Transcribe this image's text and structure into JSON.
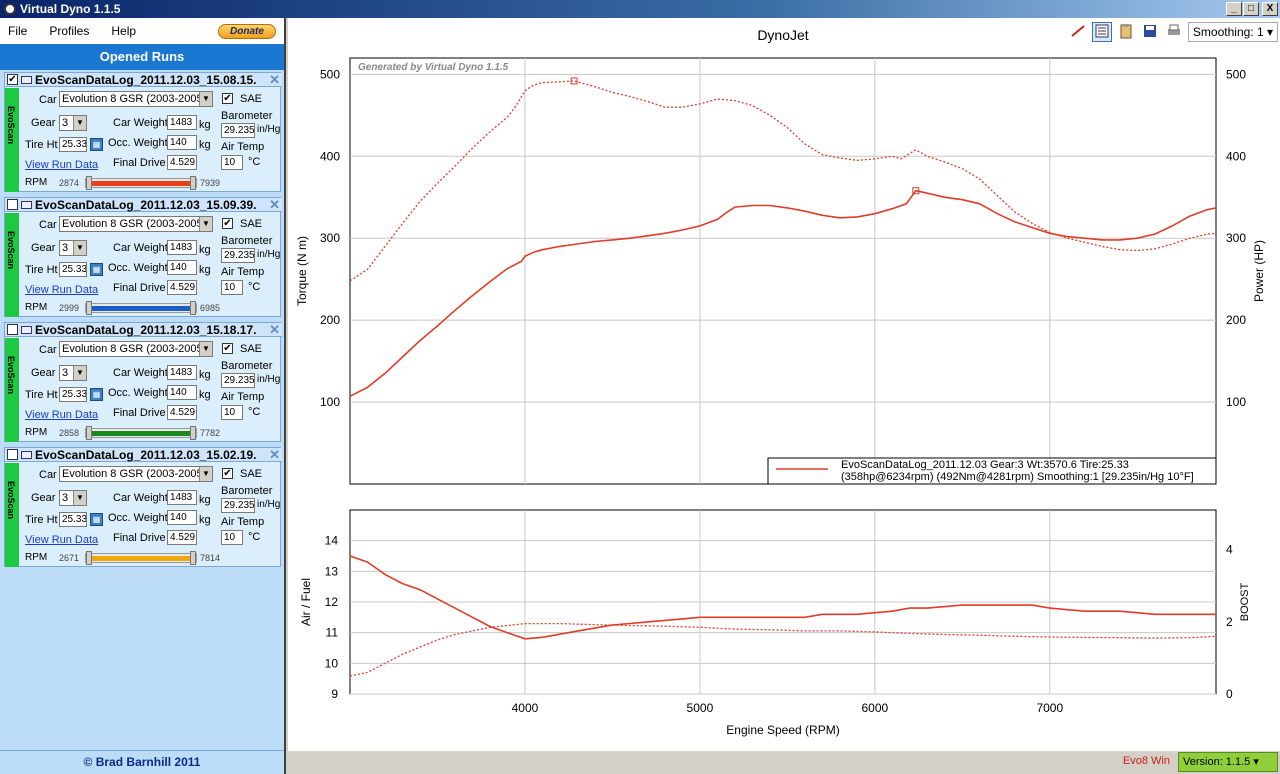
{
  "window": {
    "title": "Virtual Dyno 1.1.5",
    "controls": [
      "_",
      "□",
      "X"
    ]
  },
  "menu": {
    "items": [
      "File",
      "Profiles",
      "Help"
    ],
    "donate": "Donate"
  },
  "panel_title": "Opened Runs",
  "labels": {
    "car": "Car",
    "gear": "Gear",
    "tire": "Tire Ht",
    "car_weight": "Car Weight",
    "occ_weight": "Occ. Weight",
    "final_drive": "Final Drive",
    "sae": "SAE",
    "barometer": "Barometer",
    "air_temp": "Air Temp",
    "kg": "kg",
    "inhg": "in/Hg",
    "deg": "°C",
    "rpm": "RPM",
    "view_run": "View Run Data",
    "evoscan": "EvoScan"
  },
  "runs": [
    {
      "name": "EvoScanDataLog_2011.12.03_15.08.15.",
      "checked": "✔",
      "car": "Evolution 8 GSR (2003-2005)",
      "gear": "3",
      "tire": "25.33",
      "car_weight": "1483",
      "occ_weight": "140",
      "final_drive": "4.529",
      "barometer": "29.235",
      "air_temp": "10",
      "rpm_min": "2874",
      "rpm_max": "7939",
      "color": "#e8401a"
    },
    {
      "name": "EvoScanDataLog_2011.12.03_15.09.39.",
      "checked": "",
      "car": "Evolution 8 GSR (2003-2005)",
      "gear": "3",
      "tire": "25.33",
      "car_weight": "1483",
      "occ_weight": "140",
      "final_drive": "4.529",
      "barometer": "29.235",
      "air_temp": "10",
      "rpm_min": "2999",
      "rpm_max": "6985",
      "color": "#1a5fc8"
    },
    {
      "name": "EvoScanDataLog_2011.12.03_15.18.17.",
      "checked": "",
      "car": "Evolution 8 GSR (2003-2005)",
      "gear": "3",
      "tire": "25.33",
      "car_weight": "1483",
      "occ_weight": "140",
      "final_drive": "4.529",
      "barometer": "29.235",
      "air_temp": "10",
      "rpm_min": "2858",
      "rpm_max": "7782",
      "color": "#1a8a20"
    },
    {
      "name": "EvoScanDataLog_2011.12.03_15.02.19.",
      "checked": "",
      "car": "Evolution 8 GSR (2003-2005)",
      "gear": "3",
      "tire": "25.33",
      "car_weight": "1483",
      "occ_weight": "140",
      "final_drive": "4.529",
      "barometer": "29.235",
      "air_temp": "10",
      "rpm_min": "2671",
      "rpm_max": "7814",
      "color": "#f0a810"
    }
  ],
  "copyright": "© Brad Barnhill 2011",
  "toolbar": {
    "smoothing": "Smoothing: 1"
  },
  "status": {
    "profile": "Evo8 Win",
    "version": "Version: 1.1.5"
  },
  "colors": {
    "series": "#e03c28",
    "grid": "#c8c8c8"
  },
  "chart_data": [
    {
      "type": "line",
      "title": "DynoJet",
      "watermark": "Generated by Virtual Dyno 1.1.5",
      "ylabel": "Torque (N m)",
      "y2label": "Power (HP)",
      "xlim": [
        3000,
        7950
      ],
      "ylim": [
        0,
        520
      ],
      "y2lim": [
        0,
        520
      ],
      "yticks": [
        100,
        200,
        300,
        400,
        500
      ],
      "legend": {
        "placement": "bottom-right",
        "line1": "EvoScanDataLog_2011.12.03 Gear:3 Wt:3570.6 Tire:25.33",
        "line2": "(358hp@6234rpm) (492Nm@4281rpm) Smoothing:1 [29.235in/Hg 10°F]"
      },
      "series": [
        {
          "name": "Power",
          "axis": "right",
          "style": "solid",
          "x": [
            3000,
            3100,
            3200,
            3300,
            3400,
            3500,
            3600,
            3700,
            3800,
            3900,
            3980,
            4000,
            4050,
            4100,
            4200,
            4300,
            4400,
            4500,
            4600,
            4700,
            4800,
            4900,
            5000,
            5100,
            5150,
            5200,
            5300,
            5400,
            5500,
            5600,
            5700,
            5800,
            5900,
            6000,
            6100,
            6180,
            6234,
            6300,
            6400,
            6500,
            6600,
            6700,
            6800,
            6900,
            7000,
            7100,
            7200,
            7300,
            7400,
            7500,
            7600,
            7700,
            7800,
            7900,
            7950
          ],
          "y": [
            107,
            118,
            135,
            155,
            175,
            193,
            212,
            230,
            247,
            263,
            272,
            278,
            283,
            286,
            290,
            293,
            296,
            298,
            300,
            303,
            306,
            310,
            315,
            323,
            331,
            338,
            340,
            340,
            337,
            333,
            328,
            325,
            326,
            330,
            336,
            342,
            358,
            355,
            350,
            347,
            342,
            330,
            320,
            313,
            306,
            302,
            300,
            298,
            298,
            300,
            305,
            315,
            327,
            335,
            337
          ]
        },
        {
          "name": "Torque",
          "axis": "left",
          "style": "dotted",
          "x": [
            3000,
            3100,
            3200,
            3300,
            3400,
            3500,
            3600,
            3700,
            3800,
            3900,
            3950,
            4000,
            4050,
            4100,
            4200,
            4281,
            4400,
            4500,
            4600,
            4700,
            4800,
            4900,
            5000,
            5100,
            5200,
            5300,
            5400,
            5500,
            5600,
            5700,
            5800,
            5900,
            6000,
            6100,
            6150,
            6234,
            6300,
            6400,
            6500,
            6600,
            6700,
            6800,
            6900,
            7000,
            7100,
            7200,
            7300,
            7400,
            7500,
            7600,
            7700,
            7800,
            7900,
            7950
          ],
          "y": [
            248,
            262,
            290,
            318,
            345,
            367,
            388,
            410,
            430,
            448,
            462,
            480,
            487,
            490,
            491,
            492,
            485,
            478,
            473,
            467,
            460,
            460,
            464,
            470,
            468,
            462,
            450,
            435,
            415,
            402,
            398,
            395,
            397,
            400,
            397,
            408,
            400,
            393,
            385,
            372,
            352,
            332,
            318,
            307,
            300,
            295,
            290,
            286,
            285,
            287,
            293,
            300,
            305,
            306
          ]
        }
      ]
    },
    {
      "type": "line",
      "ylabel": "Air / Fuel",
      "y2label": "BOOST",
      "xlabel": "Engine Speed (RPM)",
      "xlim": [
        3000,
        7950
      ],
      "xticks": [
        4000,
        5000,
        6000,
        7000
      ],
      "ylim": [
        9,
        15
      ],
      "yticks": [
        9,
        10,
        11,
        12,
        13,
        14
      ],
      "y2lim": [
        0,
        5.1
      ],
      "y2ticks": [
        0,
        2,
        4
      ],
      "series": [
        {
          "name": "Air / Fuel",
          "axis": "left",
          "style": "solid",
          "x": [
            3000,
            3100,
            3200,
            3300,
            3400,
            3500,
            3600,
            3700,
            3800,
            3900,
            4000,
            4100,
            4200,
            4300,
            4400,
            4500,
            4600,
            4700,
            4800,
            4900,
            5000,
            5100,
            5200,
            5300,
            5400,
            5500,
            5600,
            5700,
            5800,
            5900,
            6000,
            6100,
            6200,
            6300,
            6400,
            6500,
            6600,
            6700,
            6800,
            6900,
            7000,
            7100,
            7200,
            7300,
            7400,
            7500,
            7600,
            7700,
            7800,
            7900,
            7950
          ],
          "y": [
            13.5,
            13.3,
            12.9,
            12.6,
            12.4,
            12.1,
            11.8,
            11.5,
            11.2,
            11.0,
            10.8,
            10.85,
            10.95,
            11.05,
            11.15,
            11.25,
            11.3,
            11.35,
            11.4,
            11.45,
            11.5,
            11.5,
            11.5,
            11.5,
            11.5,
            11.5,
            11.5,
            11.6,
            11.6,
            11.6,
            11.65,
            11.7,
            11.8,
            11.8,
            11.85,
            11.9,
            11.9,
            11.9,
            11.9,
            11.9,
            11.8,
            11.75,
            11.7,
            11.7,
            11.7,
            11.65,
            11.6,
            11.6,
            11.6,
            11.6,
            11.6
          ]
        },
        {
          "name": "BOOST",
          "axis": "right",
          "style": "dotted",
          "x": [
            3000,
            3100,
            3200,
            3300,
            3400,
            3500,
            3600,
            3700,
            3800,
            3900,
            4000,
            4200,
            4400,
            4600,
            4800,
            5000,
            5200,
            5400,
            5600,
            5800,
            6000,
            6200,
            6400,
            6600,
            6800,
            7000,
            7200,
            7400,
            7600,
            7800,
            7950
          ],
          "y": [
            0.5,
            0.6,
            0.85,
            1.1,
            1.3,
            1.5,
            1.65,
            1.75,
            1.85,
            1.9,
            1.95,
            1.95,
            1.92,
            1.9,
            1.88,
            1.85,
            1.8,
            1.78,
            1.75,
            1.75,
            1.72,
            1.68,
            1.65,
            1.63,
            1.6,
            1.58,
            1.57,
            1.56,
            1.55,
            1.56,
            1.6
          ]
        }
      ]
    }
  ]
}
